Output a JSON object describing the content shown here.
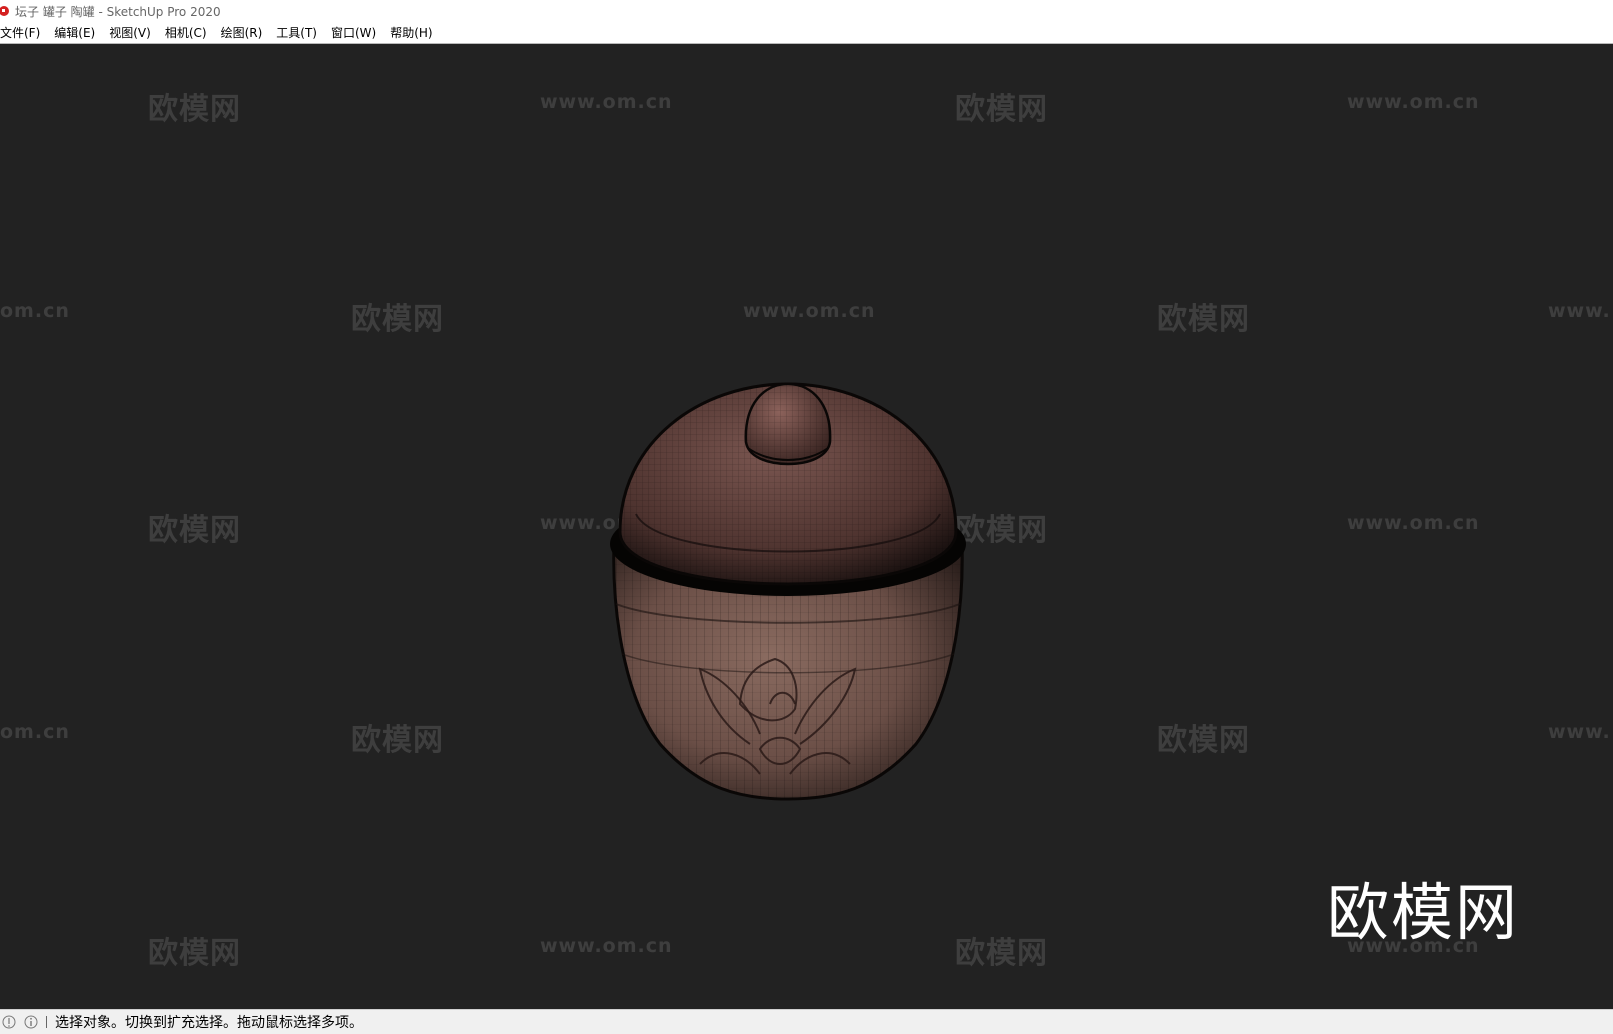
{
  "window": {
    "title": "坛子 罐子 陶罐 - SketchUp Pro 2020"
  },
  "menu": {
    "items": [
      {
        "label": "文件(F)"
      },
      {
        "label": "编辑(E)"
      },
      {
        "label": "视图(V)"
      },
      {
        "label": "相机(C)"
      },
      {
        "label": "绘图(R)"
      },
      {
        "label": "工具(T)"
      },
      {
        "label": "窗口(W)"
      },
      {
        "label": "帮助(H)"
      }
    ]
  },
  "viewport": {
    "background": "#222222",
    "watermark_cn": "欧模网",
    "watermark_url": "www.om.cn",
    "watermark_url_partial_left": "om.cn",
    "watermark_url_partial_right": "www.",
    "logo_text": "欧模网"
  },
  "status": {
    "message": "选择对象。切换到扩充选择。拖动鼠标选择多项。",
    "icons": [
      "geo-location-icon",
      "info-icon"
    ]
  },
  "colors": {
    "jar_body": "#6b4f47",
    "jar_lid": "#5a3c37",
    "app_icon_red": "#d42020"
  }
}
